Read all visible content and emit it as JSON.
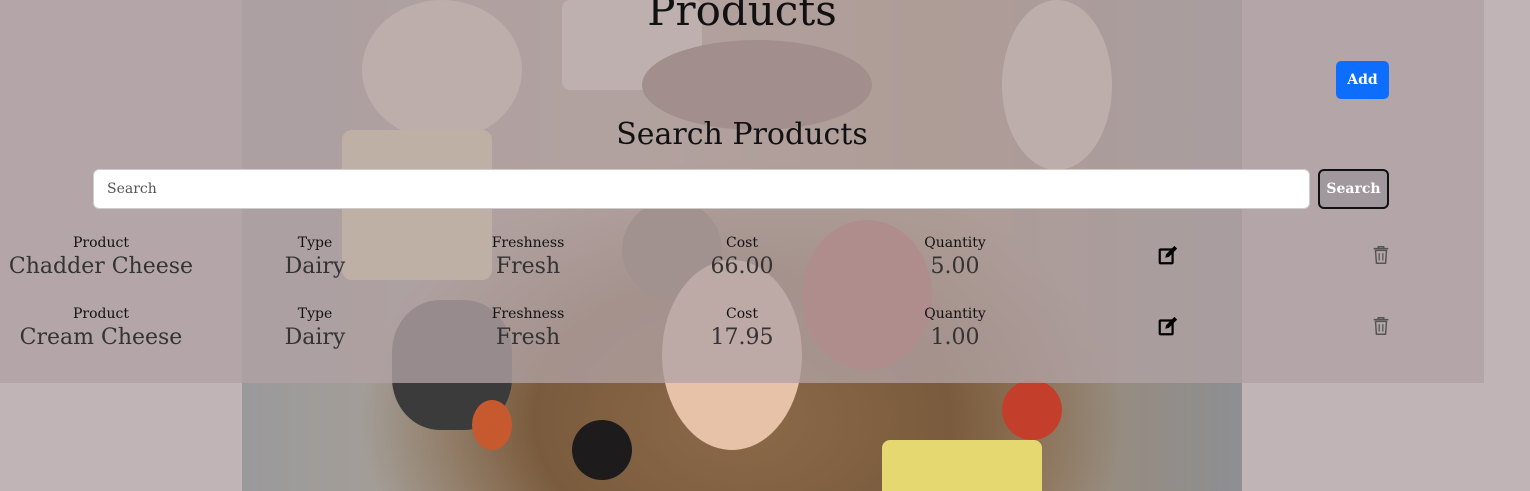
{
  "header": {
    "title": "Products",
    "add_label": "Add"
  },
  "search": {
    "title": "Search Products",
    "placeholder": "Search",
    "button_label": "Search"
  },
  "products": [
    {
      "product_label": "Product",
      "product": "Chadder Cheese",
      "type_label": "Type",
      "type": "Dairy",
      "freshness_label": "Freshness",
      "freshness": "Fresh",
      "cost_label": "Cost",
      "cost": "66.00",
      "quantity_label": "Quantity",
      "quantity": "5.00"
    },
    {
      "product_label": "Product",
      "product": "Cream Cheese",
      "type_label": "Type",
      "type": "Dairy",
      "freshness_label": "Freshness",
      "freshness": "Fresh",
      "cost_label": "Cost",
      "cost": "17.95",
      "quantity_label": "Quantity",
      "quantity": "1.00"
    }
  ],
  "icons": {
    "edit": "edit-icon",
    "delete": "trash-icon"
  },
  "colors": {
    "accent": "#0d6efd",
    "overlay": "#b1a2a4"
  }
}
